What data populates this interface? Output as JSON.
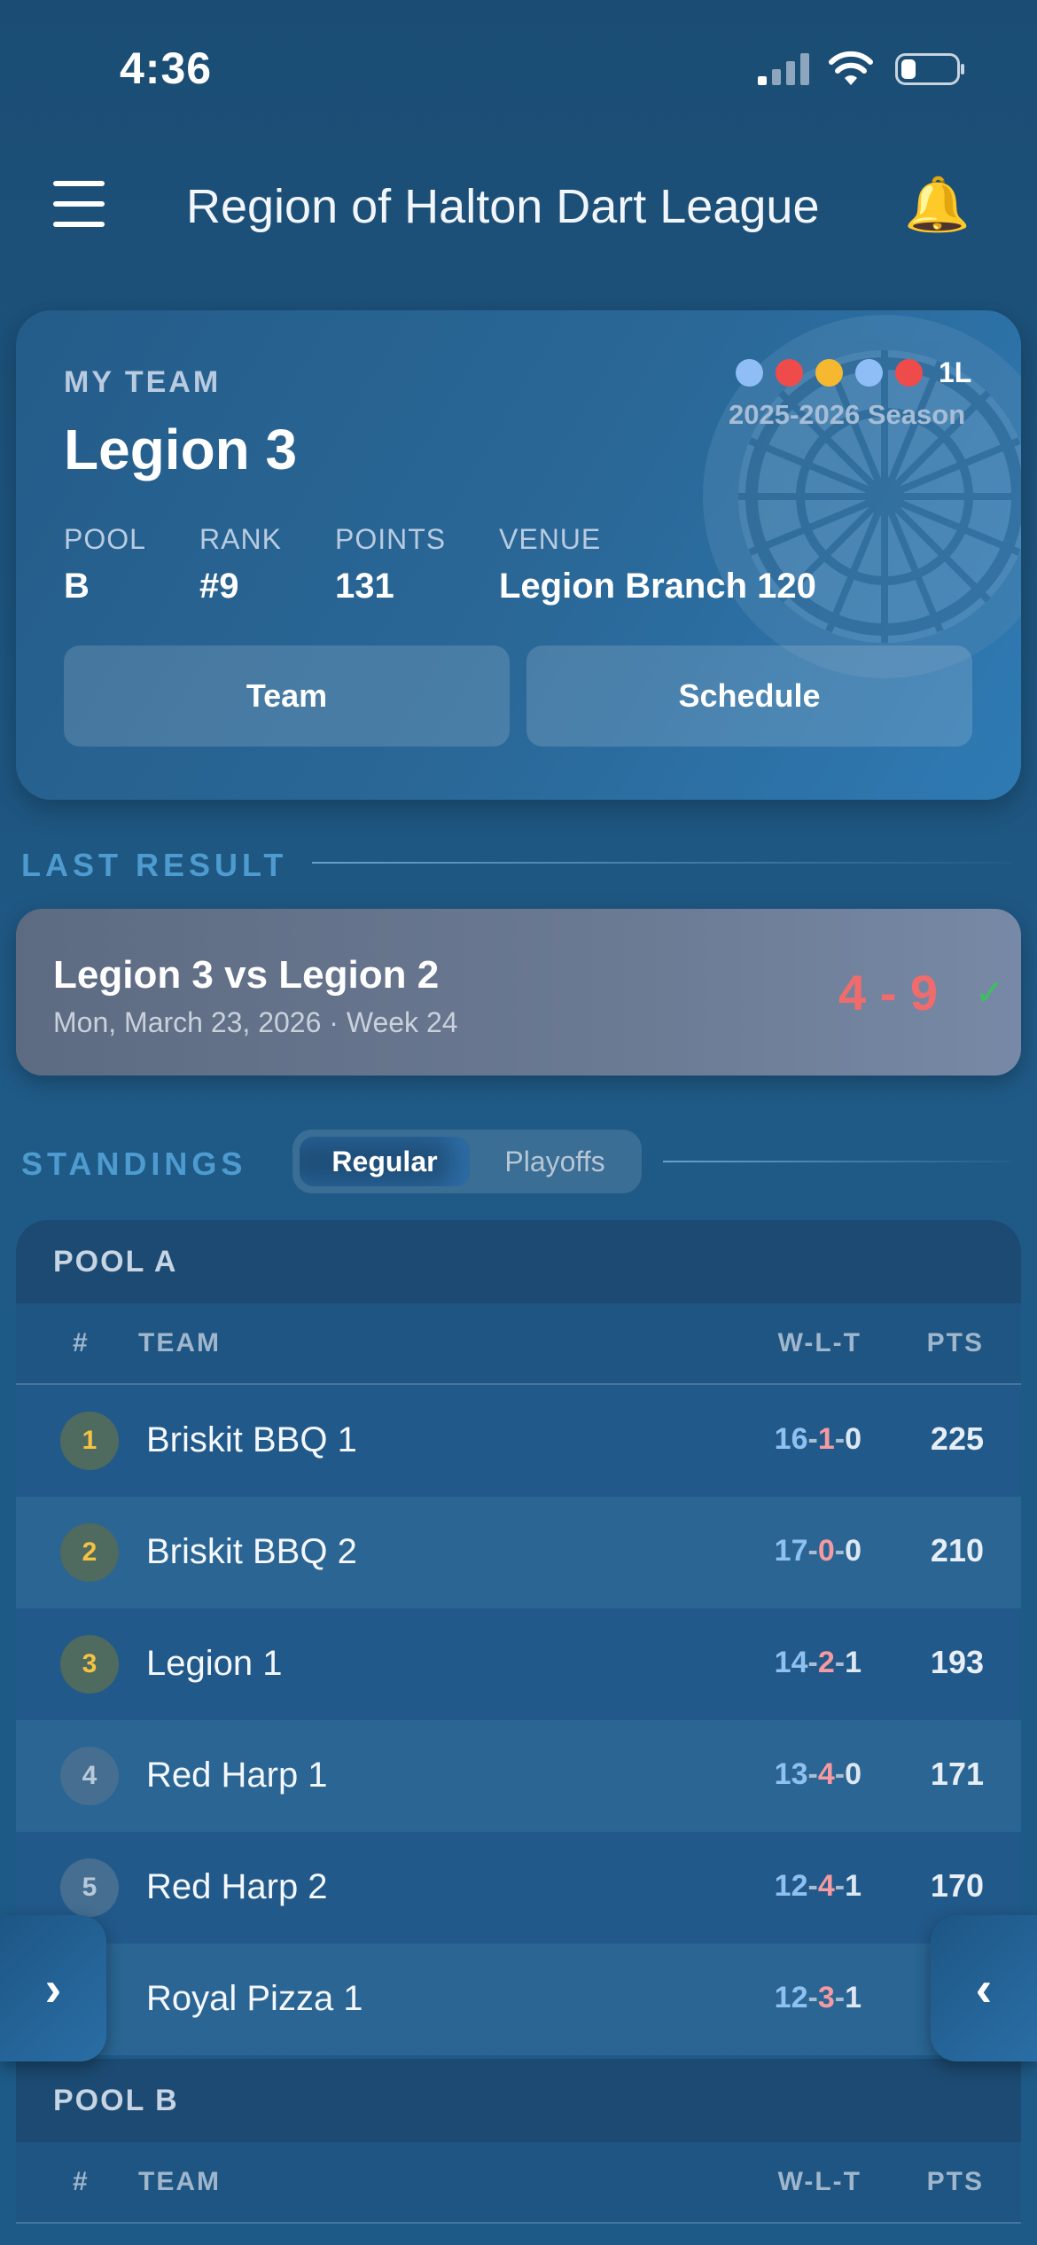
{
  "status_bar": {
    "time": "4:36"
  },
  "header": {
    "title": "Region of Halton Dart League"
  },
  "my_team": {
    "kicker": "MY TEAM",
    "name": "Legion 3",
    "form_dots": [
      "#8fbef7",
      "#ef4b4b",
      "#f5b82e",
      "#8fbef7",
      "#ef4b4b"
    ],
    "form_tag": "1L",
    "season": "2025-2026 Season",
    "stats": [
      {
        "label": "POOL",
        "value": "B"
      },
      {
        "label": "RANK",
        "value": "#9"
      },
      {
        "label": "POINTS",
        "value": "131"
      },
      {
        "label": "VENUE",
        "value": "Legion Branch 120"
      }
    ],
    "buttons": {
      "team": "Team",
      "schedule": "Schedule"
    }
  },
  "last_result": {
    "heading": "LAST RESULT",
    "matchup": "Legion 3 vs Legion 2",
    "date": "Mon, March 23, 2026 · Week 24",
    "score": "4 - 9",
    "check": "✓"
  },
  "standings": {
    "heading": "STANDINGS",
    "tabs": {
      "regular": "Regular",
      "playoffs": "Playoffs"
    },
    "columns": {
      "rank": "#",
      "team": "TEAM",
      "wlt": "W-L-T",
      "pts": "PTS"
    },
    "pool_a": {
      "title": "POOL A",
      "rows": [
        {
          "rank": "1",
          "team": "Briskit BBQ 1",
          "w": "16",
          "l": "1",
          "t": "0",
          "pts": "225"
        },
        {
          "rank": "2",
          "team": "Briskit BBQ 2",
          "w": "17",
          "l": "0",
          "t": "0",
          "pts": "210"
        },
        {
          "rank": "3",
          "team": "Legion 1",
          "w": "14",
          "l": "2",
          "t": "1",
          "pts": "193"
        },
        {
          "rank": "4",
          "team": "Red Harp 1",
          "w": "13",
          "l": "4",
          "t": "0",
          "pts": "171"
        },
        {
          "rank": "5",
          "team": "Red Harp 2",
          "w": "12",
          "l": "4",
          "t": "1",
          "pts": "170"
        },
        {
          "rank": "",
          "team": "Royal Pizza 1",
          "w": "12",
          "l": "3",
          "t": "1",
          "pts": ""
        }
      ]
    },
    "pool_b": {
      "title": "POOL B"
    }
  },
  "side_nav": {
    "left": "›",
    "right": "‹"
  }
}
